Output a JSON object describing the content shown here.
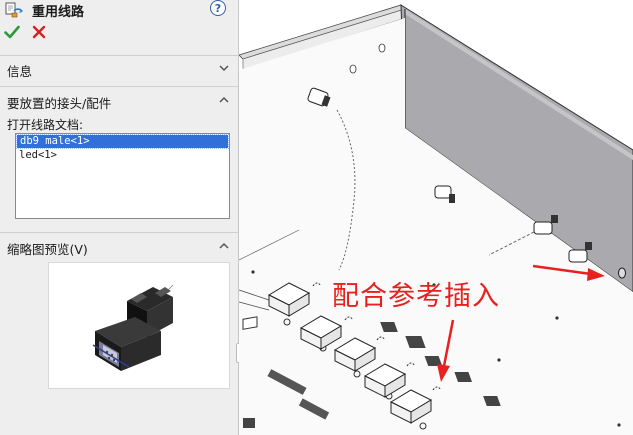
{
  "property_manager": {
    "title": "重用线路",
    "icon": "route-reuse-icon",
    "help_icon_glyph": "?",
    "ok_icon": "checkmark-icon",
    "cancel_icon": "x-icon"
  },
  "sections": {
    "info": {
      "title": "信息",
      "state": "collapsed"
    },
    "components": {
      "title": "要放置的接头/配件",
      "state": "expanded"
    },
    "preview": {
      "title": "缩略图预览(V)",
      "state": "expanded"
    }
  },
  "open_documents": {
    "label": "打开线路文档:",
    "items": [
      {
        "text": "db9 male<1>",
        "selected": true
      },
      {
        "text": "led<1>",
        "selected": false
      }
    ]
  },
  "annotation": {
    "text": "配合参考插入",
    "color": "#e82020"
  },
  "colors": {
    "selection": "#3070d8",
    "ok_green": "#2a9a3a",
    "cancel_red": "#d42020",
    "help_blue": "#2f5ea8"
  }
}
